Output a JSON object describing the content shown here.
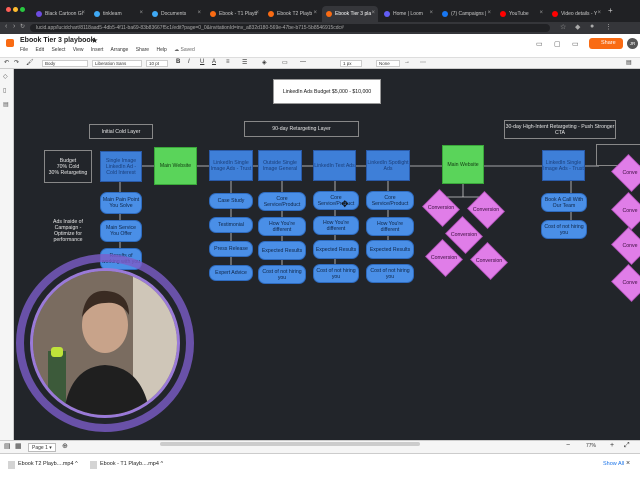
{
  "browser": {
    "tabs": [
      {
        "label": "Black Cartoon Gi",
        "color": "#6d4ce0"
      },
      {
        "label": "tinkleam",
        "color": "#3fa9f5"
      },
      {
        "label": "Documents",
        "color": "#3fa9f5"
      },
      {
        "label": "Ebook - T1 Playb",
        "color": "#f96b13"
      },
      {
        "label": "Ebook T2 Playb",
        "color": "#f96b13"
      },
      {
        "label": "Ebook Tier 3 pla",
        "color": "#f96b13"
      },
      {
        "label": "Home | Loom",
        "color": "#625df5"
      },
      {
        "label": "(7) Campaigns |",
        "color": "#1877f2"
      },
      {
        "label": "YouTube",
        "color": "#ff0000"
      },
      {
        "label": "Video details - Y",
        "color": "#ff0000"
      }
    ],
    "url": "lucid.app/lucidchart/8118aad5-4db5-4f11-ba69-83b83667f5c1/edit?page=0_0&invitationId=inv_a832d180-569e-47be-b715-5b8546915cdc#"
  },
  "app": {
    "doc_title": "Ebook Tier 3 playbook",
    "menu": [
      "File",
      "Edit",
      "Select",
      "View",
      "Insert",
      "Arrange",
      "Share",
      "Help"
    ],
    "saved": "Saved",
    "share_label": "Share",
    "avatar_initials": "JR"
  },
  "toolbar": {
    "style": "Body",
    "font": "Liberation Sans",
    "font_size": "10 pt",
    "line_width": "1 px",
    "arrow": "None"
  },
  "canvas": {
    "budget_title": "LinkedIn Ads Budget $5,000 - $10,000",
    "layer_cold": "Initial Cold Layer",
    "layer_retarget": "90-day Retargeting Layer",
    "layer_high_intent": "30-day High-Intent Retargeting - Push Stronger CTA",
    "budget_note": "Budget\n70% Cold\n30% Retargeting",
    "ads_inside": "Ads Inside of Campaign - Optimize for performance",
    "col1_header": "Single Image LinkedIn Ad - Cold Interest",
    "col1_items": [
      "Main Pain Point You Solve",
      "Main Service You Offer",
      "Results of working with you"
    ],
    "main_website": "Main Website",
    "col2_header": "LinkedIn Single Image Ads - Trust",
    "col2_items": [
      "Case Study",
      "Testimonial",
      "Press Release",
      "Expert Advice"
    ],
    "col3_header": "Outside Single Image General",
    "col3_items": [
      "Core Service/Product",
      "How You're different",
      "Expected Results",
      "Cost of not hiring you"
    ],
    "col4_header": "LinkedIn Text Ads",
    "col4_items": [
      "Core Service/Product",
      "How You're different",
      "Expected Results",
      "Cost of not hiring you"
    ],
    "col5_header": "LinkedIn Spotlight Ads",
    "col5_items": [
      "Core Service/Product",
      "How You're different",
      "Expected Results",
      "Cost of not hiring you"
    ],
    "main_website_2": "Main Website",
    "conversion": "Conversion",
    "col6_header": "LinkedIn Single Image Ads - Trust",
    "col6_items": [
      "Book A Call With Our Team",
      "Cost of not hiring you"
    ],
    "right_conv": [
      "Conve",
      "Conve",
      "Conve",
      "Conve"
    ]
  },
  "bottom": {
    "page_tab": "Page 1",
    "zoom": "77%"
  },
  "downloads": {
    "items": [
      "Ebook T2 Playb....mp4",
      "Ebook - T1 Playb....mp4"
    ],
    "show_all": "Show All"
  }
}
